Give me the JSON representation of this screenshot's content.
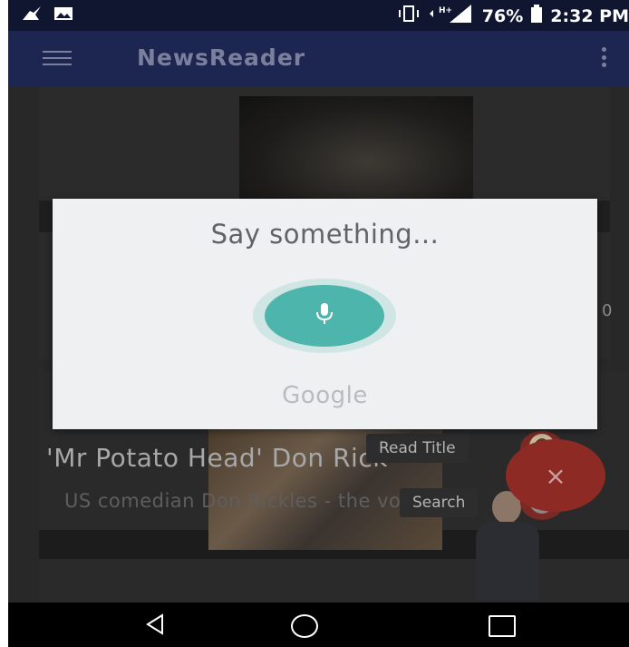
{
  "status_bar": {
    "battery": "76%",
    "time": "2:32 PM",
    "network": "H+"
  },
  "app_bar": {
    "title": "NewsReader"
  },
  "feed": {
    "headline": "'Mr Potato Head' Don Rick",
    "subline": "US comedian Don Rickles - the voice",
    "peek_digit": "0"
  },
  "fab": {
    "read_title_label": "Read Title",
    "search_label": "Search",
    "close_symbol": "×"
  },
  "voice_dialog": {
    "prompt": "Say something...",
    "brand": "Google"
  },
  "colors": {
    "status_bar": "#101530",
    "app_bar": "#1c2650",
    "mic_accent": "#4db5ab",
    "fab_red": "#8e2a24"
  },
  "icons": [
    "hamburger-menu-icon",
    "overflow-menu-icon",
    "microphone-icon",
    "back-icon",
    "home-icon",
    "recents-icon",
    "avatar-icon",
    "record-icon",
    "close-icon"
  ]
}
